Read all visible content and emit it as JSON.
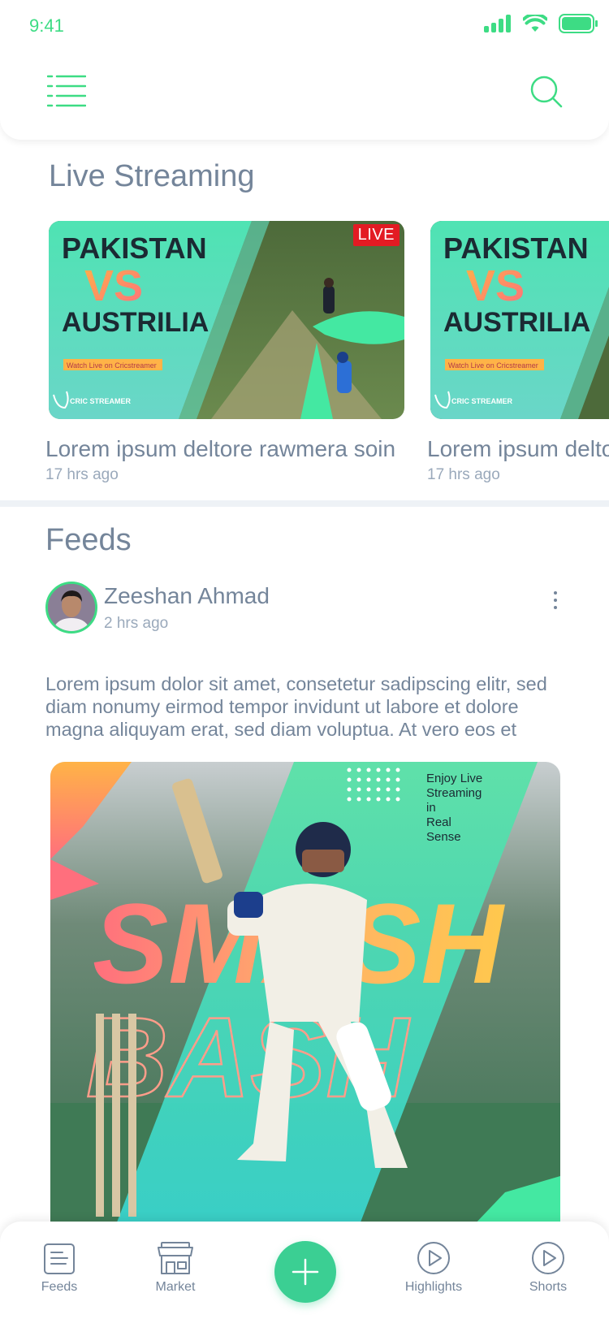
{
  "status_bar": {
    "time": "9:41"
  },
  "header": {
    "menu_icon": "list-menu-icon",
    "search_icon": "search-icon"
  },
  "live_streaming": {
    "title": "Live Streaming",
    "cards": [
      {
        "team1": "PAKISTAN",
        "vs": "VS",
        "team2": "AUSTRILIA",
        "tagline": "Watch Live on Cricstreamer",
        "brand": "CRIC STREAMER",
        "badge": "LIVE",
        "title": "Lorem ipsum deltore rawmera soin",
        "time": "17 hrs ago"
      },
      {
        "team1": "PAKISTAN",
        "vs": "VS",
        "team2": "AUSTRILIA",
        "tagline": "Watch Live on Cricstreamer",
        "brand": "CRIC STREAMER",
        "title": "Lorem ipsum deltore rawmera soin",
        "time": "17 hrs ago"
      }
    ]
  },
  "feeds": {
    "title": "Feeds",
    "post": {
      "author": "Zeeshan Ahmad",
      "time": "2 hrs ago",
      "text": "Lorem ipsum dolor sit amet, consetetur sadipscing elitr, sed diam nonumy eirmod tempor invidunt ut labore et dolore magna aliquyam erat, sed diam voluptua. At vero eos et",
      "image": {
        "promo_line1": "Enjoy Live",
        "promo_line2": "Streaming",
        "promo_line3": "in",
        "promo_line4": "Real",
        "promo_line5": "Sense",
        "headline1": "SMASH",
        "headline2": "BASH"
      }
    }
  },
  "bottom_nav": {
    "items": [
      {
        "label": "Feeds",
        "icon": "document-icon"
      },
      {
        "label": "Market",
        "icon": "store-icon"
      },
      {
        "label": "",
        "icon": "plus-icon"
      },
      {
        "label": "Highlights",
        "icon": "play-circle-icon"
      },
      {
        "label": "Shorts",
        "icon": "play-circle-icon"
      }
    ]
  },
  "colors": {
    "accent": "#3ddc84",
    "text": "#74859a",
    "muted": "#9aa9bb",
    "live": "#e31b23"
  }
}
